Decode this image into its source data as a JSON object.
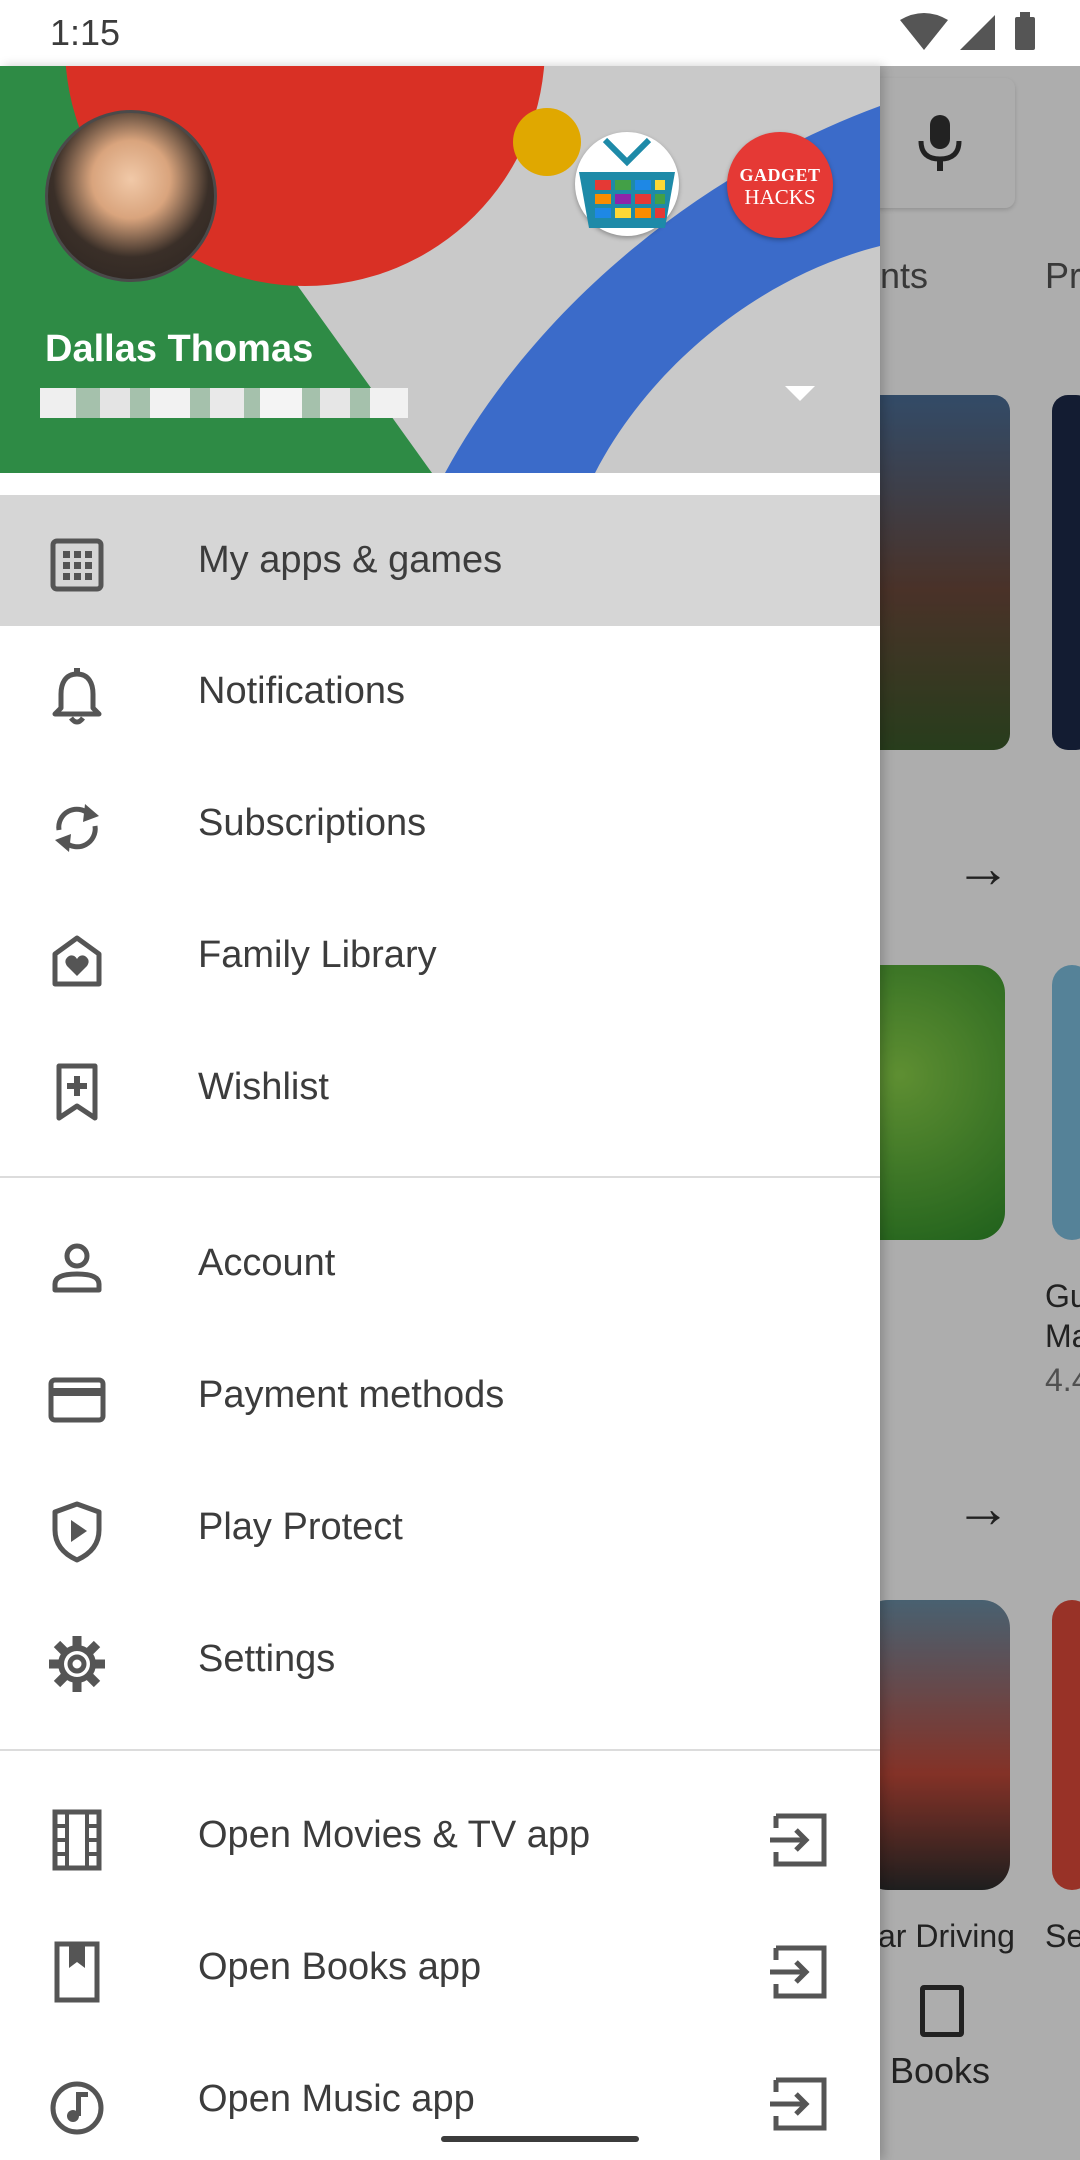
{
  "status_bar": {
    "time": "1:15",
    "icons": [
      "wifi-icon",
      "cellular-signal-icon",
      "battery-icon"
    ]
  },
  "background_page": {
    "tabs": [
      "ents",
      "Pr"
    ],
    "game_labels": [
      "Gu",
      "Ma",
      "4.4"
    ],
    "app_label": "ar Driving",
    "app_label_2": "Se",
    "bottom_nav_books": "Books"
  },
  "drawer": {
    "header": {
      "user_name": "Dallas Thomas",
      "secondary_account_badge": "GADGET",
      "secondary_account_badge_2": "HACKS",
      "header_colors": [
        "#2e8b45",
        "#d93025",
        "#3b6bc9",
        "#e0a800"
      ]
    },
    "menu_primary": [
      {
        "label": "My apps & games",
        "icon": "apps-grid-icon",
        "selected": true
      },
      {
        "label": "Notifications",
        "icon": "bell-icon"
      },
      {
        "label": "Subscriptions",
        "icon": "refresh-icon"
      },
      {
        "label": "Family Library",
        "icon": "family-heart-icon"
      },
      {
        "label": "Wishlist",
        "icon": "bookmark-add-icon"
      }
    ],
    "menu_account": [
      {
        "label": "Account",
        "icon": "person-icon"
      },
      {
        "label": "Payment methods",
        "icon": "credit-card-icon"
      },
      {
        "label": "Play Protect",
        "icon": "shield-play-icon"
      },
      {
        "label": "Settings",
        "icon": "gear-icon"
      }
    ],
    "menu_apps": [
      {
        "label": "Open Movies & TV app",
        "icon": "film-strip-icon"
      },
      {
        "label": "Open Books app",
        "icon": "book-bookmark-icon"
      },
      {
        "label": "Open Music app",
        "icon": "music-note-icon"
      }
    ]
  }
}
